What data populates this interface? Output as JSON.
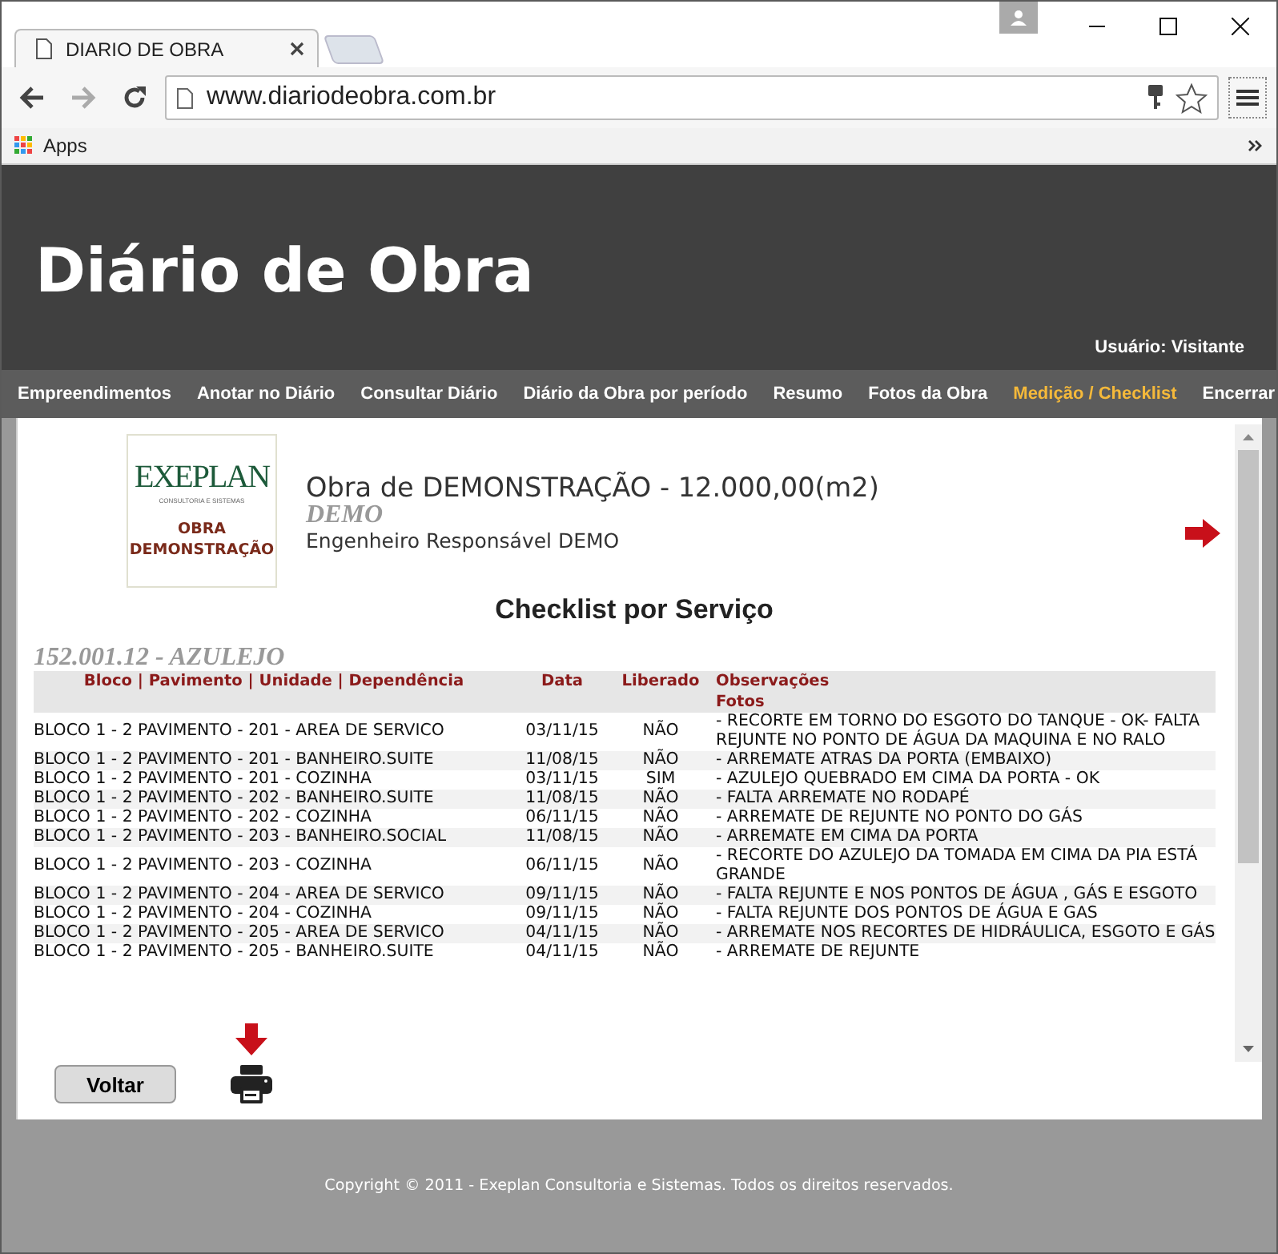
{
  "browser": {
    "tab_title": "DIARIO DE OBRA",
    "url": "www.diariodeobra.com.br",
    "bookmarks": [
      "Apps"
    ]
  },
  "header": {
    "title": "Diário de Obra",
    "user": "Usuário: Visitante"
  },
  "nav": [
    {
      "label": "Empreendimentos",
      "selected": false
    },
    {
      "label": "Anotar no Diário",
      "selected": false
    },
    {
      "label": "Consultar Diário",
      "selected": false
    },
    {
      "label": "Diário da Obra por período",
      "selected": false
    },
    {
      "label": "Resumo",
      "selected": false
    },
    {
      "label": "Fotos da Obra",
      "selected": false
    },
    {
      "label": "Medição / Checklist",
      "selected": true
    },
    {
      "label": "Encerrar",
      "selected": false
    }
  ],
  "project": {
    "logo": {
      "name": "EXEPLAN",
      "tagline": "CONSULTORIA E SISTEMAS",
      "caption": "OBRA DEMONSTRAÇÃO"
    },
    "title": "Obra de DEMONSTRAÇÃO - 12.000,00(m2)",
    "subtitle": "DEMO",
    "engineer": "Engenheiro Responsável DEMO"
  },
  "checklist": {
    "title": "Checklist por Serviço",
    "service": "152.001.12 - AZULEJO",
    "columns": [
      "Bloco | Pavimento | Unidade | Dependência",
      "Data",
      "Liberado",
      "Observações"
    ],
    "subheader": "Fotos",
    "rows": [
      {
        "unit": "BLOCO 1 - 2 PAVIMENTO - 201 - AREA DE SERVICO",
        "date": "03/11/15",
        "released": "NÃO",
        "observation": "- RECORTE EM TORNO DO ESGOTO DO TANQUE - OK- FALTA REJUNTE NO PONTO DE ÁGUA DA MAQUINA E NO RALO"
      },
      {
        "unit": "BLOCO 1 - 2 PAVIMENTO - 201 - BANHEIRO.SUITE",
        "date": "11/08/15",
        "released": "NÃO",
        "observation": "- ARREMATE ATRAS DA PORTA (EMBAIXO)"
      },
      {
        "unit": "BLOCO 1 - 2 PAVIMENTO - 201 - COZINHA",
        "date": "03/11/15",
        "released": "SIM",
        "observation": "- AZULEJO QUEBRADO EM CIMA DA PORTA - OK"
      },
      {
        "unit": "BLOCO 1 - 2 PAVIMENTO - 202 - BANHEIRO.SUITE",
        "date": "11/08/15",
        "released": "NÃO",
        "observation": "- FALTA ARREMATE NO RODAPÉ"
      },
      {
        "unit": "BLOCO 1 - 2 PAVIMENTO - 202 - COZINHA",
        "date": "06/11/15",
        "released": "NÃO",
        "observation": "- ARREMATE DE REJUNTE NO PONTO DO GÁS"
      },
      {
        "unit": "BLOCO 1 - 2 PAVIMENTO - 203 - BANHEIRO.SOCIAL",
        "date": "11/08/15",
        "released": "NÃO",
        "observation": "- ARREMATE EM CIMA DA PORTA"
      },
      {
        "unit": "BLOCO 1 - 2 PAVIMENTO - 203 - COZINHA",
        "date": "06/11/15",
        "released": "NÃO",
        "observation": "- RECORTE DO AZULEJO DA TOMADA EM CIMA DA PIA ESTÁ GRANDE"
      },
      {
        "unit": "BLOCO 1 - 2 PAVIMENTO - 204 - AREA DE SERVICO",
        "date": "09/11/15",
        "released": "NÃO",
        "observation": "- FALTA REJUNTE E NOS PONTOS DE ÁGUA , GÁS E ESGOTO"
      },
      {
        "unit": "BLOCO 1 - 2 PAVIMENTO - 204 - COZINHA",
        "date": "09/11/15",
        "released": "NÃO",
        "observation": "- FALTA REJUNTE DOS PONTOS DE ÁGUA E GAS"
      },
      {
        "unit": "BLOCO 1 - 2 PAVIMENTO - 205 - AREA DE SERVICO",
        "date": "04/11/15",
        "released": "NÃO",
        "observation": "- ARREMATE NOS RECORTES DE HIDRÁULICA, ESGOTO E GÁS"
      },
      {
        "unit": "BLOCO 1 - 2 PAVIMENTO - 205 - BANHEIRO.SUITE",
        "date": "04/11/15",
        "released": "NÃO",
        "observation": "- ARREMATE DE REJUNTE"
      }
    ]
  },
  "actions": {
    "back_button": "Voltar"
  },
  "footer": {
    "copyright": "Copyright © 2011 - Exeplan Consultoria e Sistemas. Todos os direitos reservados."
  }
}
